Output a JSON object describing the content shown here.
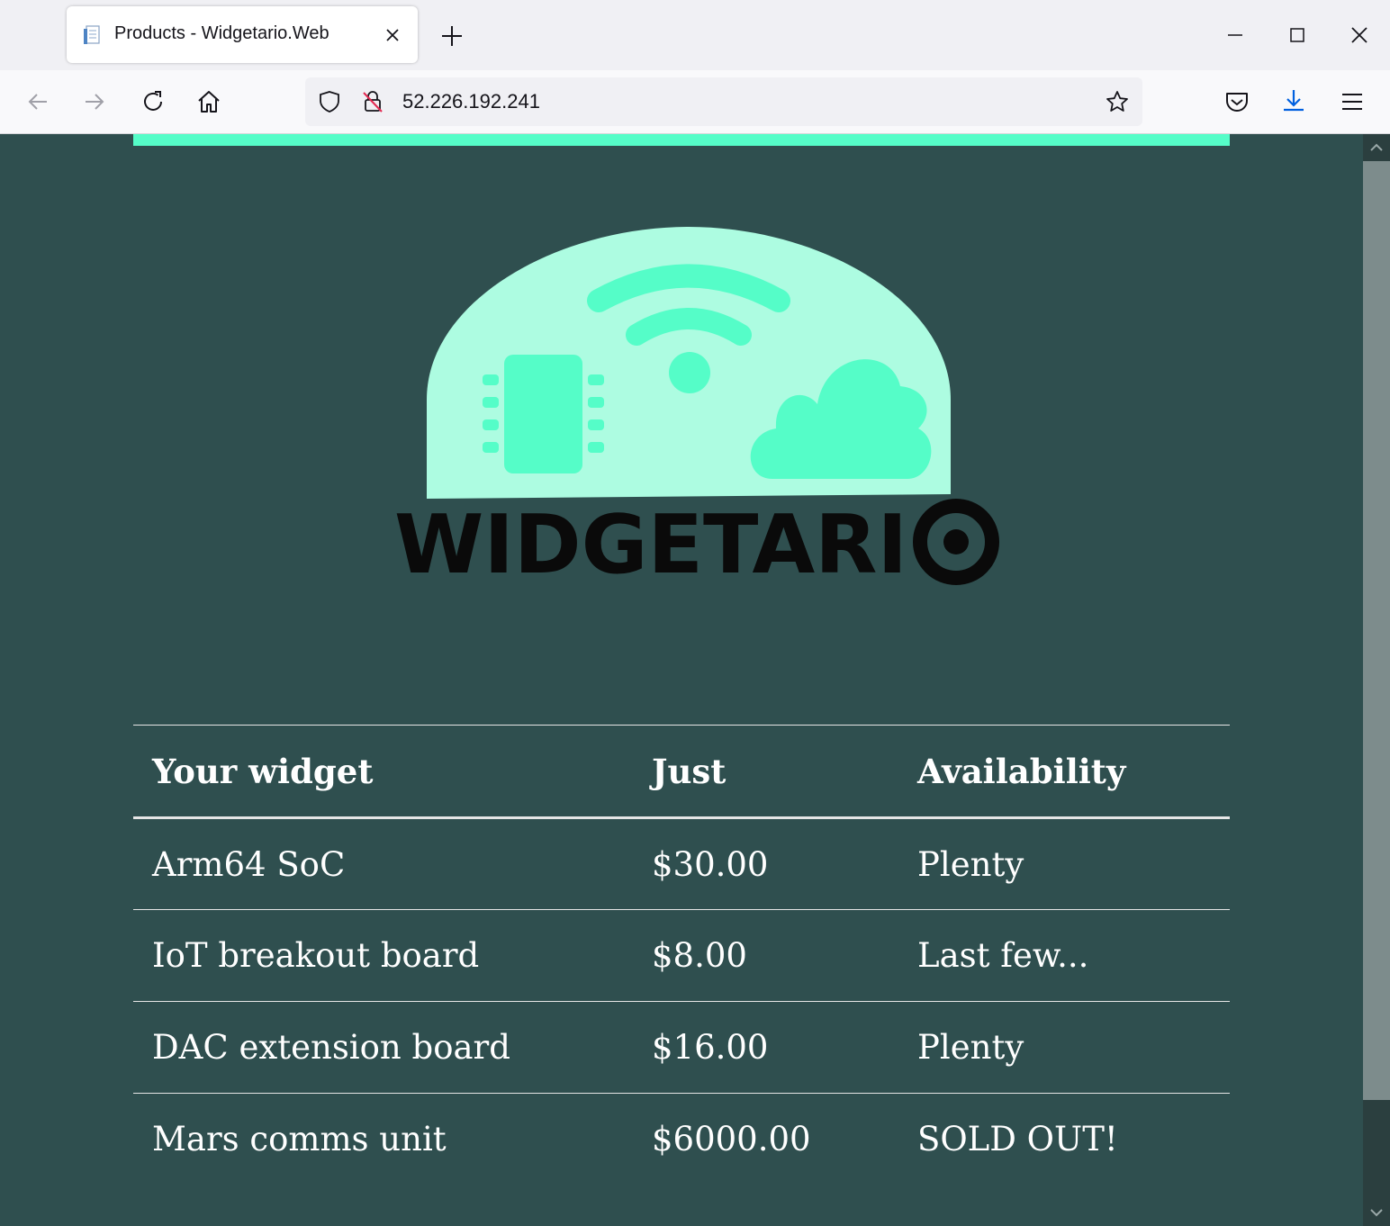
{
  "browser": {
    "tab_title": "Products - Widgetario.Web",
    "url": "52.226.192.241"
  },
  "page": {
    "logo_wordmark": "WIDGETARIO",
    "accent_color": "#55fdc8",
    "background_color": "#2f4f4f",
    "table": {
      "headers": [
        "Your widget",
        "Just",
        "Availability"
      ],
      "rows": [
        [
          "Arm64 SoC",
          "$30.00",
          "Plenty"
        ],
        [
          "IoT breakout board",
          "$8.00",
          "Last few..."
        ],
        [
          "DAC extension board",
          "$16.00",
          "Plenty"
        ],
        [
          "Mars comms unit",
          "$6000.00",
          "SOLD OUT!"
        ]
      ]
    }
  }
}
